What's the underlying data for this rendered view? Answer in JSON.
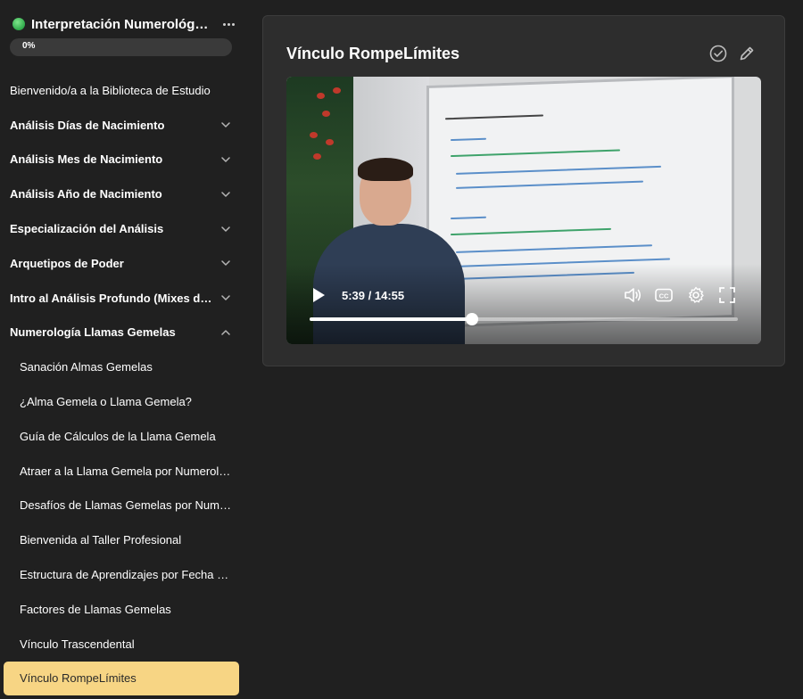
{
  "course": {
    "title": "Interpretación Numerológica Avanzada",
    "progress_label": "0%",
    "progress": 0
  },
  "sidebar": {
    "items": [
      {
        "label": "Bienvenido/a a la Biblioteca de Estudio",
        "type": "link"
      },
      {
        "label": "Análisis Días de Nacimiento",
        "type": "section",
        "expanded": false
      },
      {
        "label": "Análisis Mes de Nacimiento",
        "type": "section",
        "expanded": false
      },
      {
        "label": "Análisis Año de Nacimiento",
        "type": "section",
        "expanded": false
      },
      {
        "label": "Especialización del Análisis",
        "type": "section",
        "expanded": false
      },
      {
        "label": "Arquetipos de Poder",
        "type": "section",
        "expanded": false
      },
      {
        "label": "Intro al Análisis Profundo (Mixes de Números)",
        "type": "section",
        "expanded": false
      },
      {
        "label": "Numerología Llamas Gemelas",
        "type": "section",
        "expanded": true
      },
      {
        "label": "Sanación Almas Gemelas",
        "type": "lesson"
      },
      {
        "label": "¿Alma Gemela o Llama Gemela?",
        "type": "lesson"
      },
      {
        "label": "Guía de Cálculos de la Llama Gemela",
        "type": "lesson"
      },
      {
        "label": "Atraer a la Llama Gemela por Numerología",
        "type": "lesson"
      },
      {
        "label": "Desafíos de Llamas Gemelas por Numerología",
        "type": "lesson"
      },
      {
        "label": "Bienvenida al Taller Profesional",
        "type": "lesson"
      },
      {
        "label": "Estructura de Aprendizajes por Fecha de Nacimiento",
        "type": "lesson"
      },
      {
        "label": "Factores de Llamas Gemelas",
        "type": "lesson"
      },
      {
        "label": "Vínculo Trascendental",
        "type": "lesson"
      },
      {
        "label": "Vínculo RompeLímites",
        "type": "lesson",
        "active": true
      }
    ]
  },
  "lesson": {
    "title": "Vínculo RompeLímites",
    "icons": [
      "check-circle-icon",
      "pencil-icon"
    ]
  },
  "video": {
    "time_label": "5:39 / 14:55",
    "progress": 0.379,
    "controls": [
      "play-icon",
      "volume-icon",
      "captions-icon",
      "settings-icon",
      "fullscreen-icon"
    ]
  },
  "colors": {
    "background": "#202020",
    "active_item": "#f7d584",
    "card": "#2d2d2d",
    "status_dot": "#2fa84a"
  }
}
